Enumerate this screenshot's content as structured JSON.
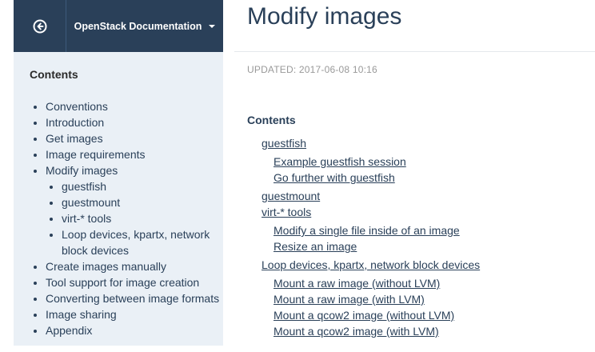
{
  "sidebar": {
    "doc_title": "OpenStack Documentation",
    "toc_heading": "Contents",
    "items": [
      {
        "label": "Conventions"
      },
      {
        "label": "Introduction"
      },
      {
        "label": "Get images"
      },
      {
        "label": "Image requirements"
      },
      {
        "label": "Modify images",
        "children": [
          "guestfish",
          "guestmount",
          "virt-* tools",
          "Loop devices, kpartx, network block devices"
        ]
      },
      {
        "label": "Create images manually"
      },
      {
        "label": "Tool support for image creation"
      },
      {
        "label": "Converting between image formats"
      },
      {
        "label": "Image sharing"
      },
      {
        "label": "Appendix"
      }
    ]
  },
  "main": {
    "title": "Modify images",
    "updated": "UPDATED: 2017-06-08 10:16",
    "contents_heading": "Contents",
    "links": {
      "guestfish": "guestfish",
      "example_session": "Example guestfish session",
      "go_further": "Go further with guestfish",
      "guestmount": "guestmount",
      "virt_tools": "virt-* tools",
      "modify_single_file": "Modify a single file inside of an image",
      "resize_image": "Resize an image",
      "loop_devices": "Loop devices, kpartx, network block devices",
      "raw_no_lvm": "Mount a raw image (without LVM)",
      "raw_lvm": "Mount a raw image (with LVM)",
      "qcow2_no_lvm": "Mount a qcow2 image (without LVM)",
      "qcow2_lvm": "Mount a qcow2 image (with LVM)"
    }
  }
}
